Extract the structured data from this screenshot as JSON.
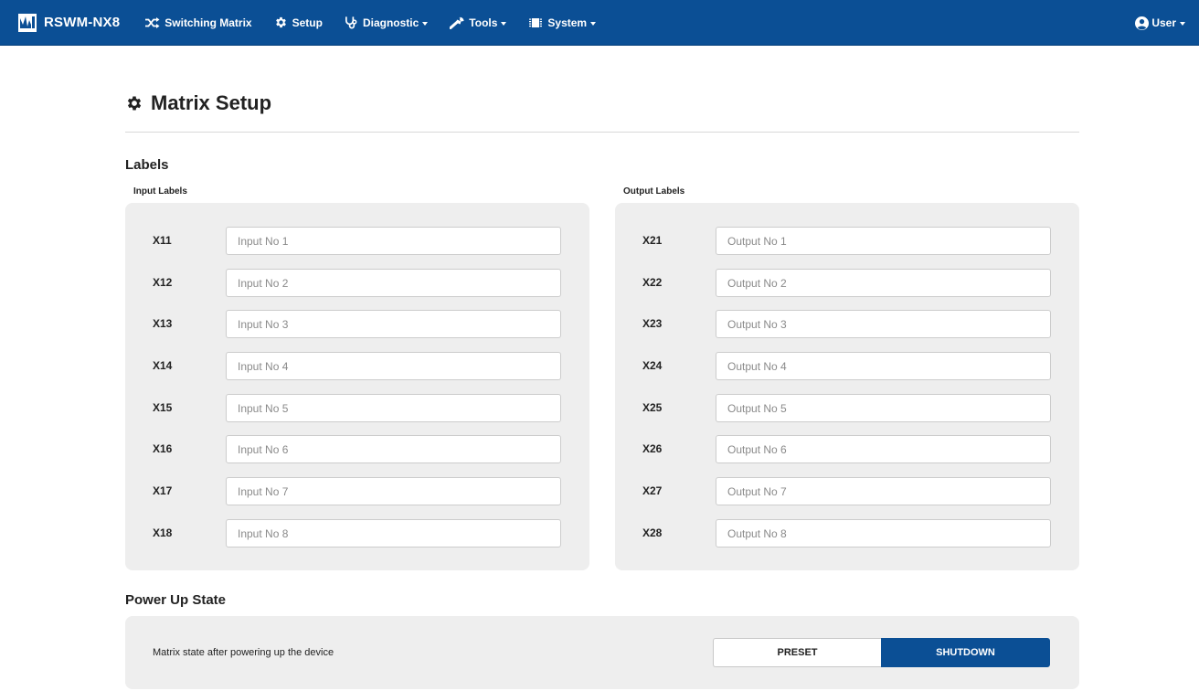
{
  "navbar": {
    "brand": "RSWM-NX8",
    "items": [
      {
        "label": "Switching Matrix",
        "icon": "shuffle-icon",
        "dropdown": false
      },
      {
        "label": "Setup",
        "icon": "gear-icon",
        "dropdown": false
      },
      {
        "label": "Diagnostic",
        "icon": "stethoscope-icon",
        "dropdown": true
      },
      {
        "label": "Tools",
        "icon": "wrench-icon",
        "dropdown": true
      },
      {
        "label": "System",
        "icon": "chip-icon",
        "dropdown": true
      }
    ],
    "user": "User"
  },
  "page": {
    "title": "Matrix Setup"
  },
  "labels": {
    "heading": "Labels",
    "inputs": {
      "title": "Input Labels",
      "rows": [
        {
          "id": "X11",
          "value": "",
          "placeholder": "Input No 1"
        },
        {
          "id": "X12",
          "value": "",
          "placeholder": "Input No 2"
        },
        {
          "id": "X13",
          "value": "",
          "placeholder": "Input No 3"
        },
        {
          "id": "X14",
          "value": "",
          "placeholder": "Input No 4"
        },
        {
          "id": "X15",
          "value": "",
          "placeholder": "Input No 5"
        },
        {
          "id": "X16",
          "value": "",
          "placeholder": "Input No 6"
        },
        {
          "id": "X17",
          "value": "",
          "placeholder": "Input No 7"
        },
        {
          "id": "X18",
          "value": "",
          "placeholder": "Input No 8"
        }
      ]
    },
    "outputs": {
      "title": "Output Labels",
      "rows": [
        {
          "id": "X21",
          "value": "",
          "placeholder": "Output No 1"
        },
        {
          "id": "X22",
          "value": "",
          "placeholder": "Output No 2"
        },
        {
          "id": "X23",
          "value": "",
          "placeholder": "Output No 3"
        },
        {
          "id": "X24",
          "value": "",
          "placeholder": "Output No 4"
        },
        {
          "id": "X25",
          "value": "",
          "placeholder": "Output No 5"
        },
        {
          "id": "X26",
          "value": "",
          "placeholder": "Output No 6"
        },
        {
          "id": "X27",
          "value": "",
          "placeholder": "Output No 7"
        },
        {
          "id": "X28",
          "value": "",
          "placeholder": "Output No 8"
        }
      ]
    }
  },
  "power_up": {
    "heading": "Power Up State",
    "description": "Matrix state after powering up the device",
    "options": [
      "PRESET",
      "SHUTDOWN"
    ],
    "selected": "SHUTDOWN"
  },
  "colors": {
    "navbar": "#0b4f95",
    "panel": "#eeeeee",
    "selected": "#0b4f95"
  }
}
